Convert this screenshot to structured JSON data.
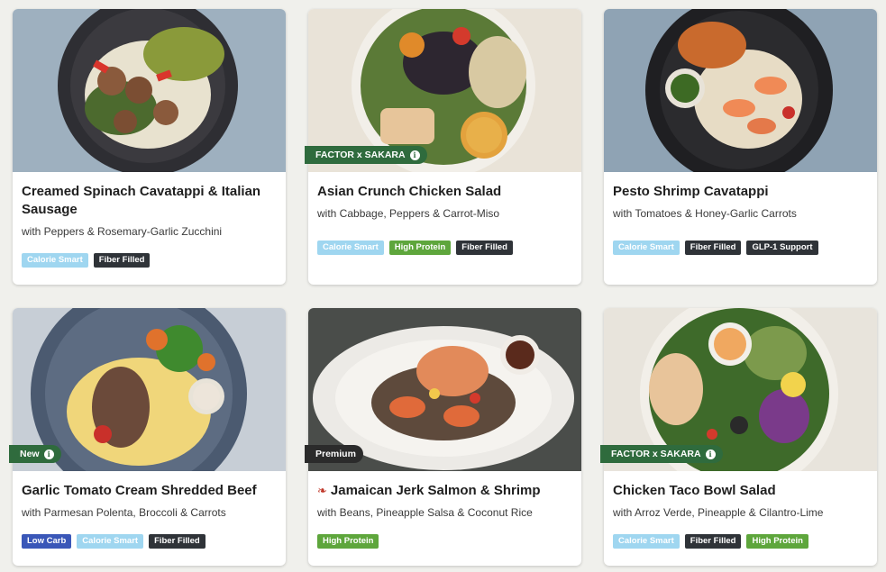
{
  "cards": [
    {
      "title": "Creamed Spinach Cavatappi & Italian Sausage",
      "subtitle": "with Peppers & Rosemary-Garlic Zucchini",
      "tags": [
        "Calorie Smart",
        "Fiber Filled"
      ],
      "image": "pasta-sausage-bowl-image"
    },
    {
      "title": "Asian Crunch Chicken Salad",
      "subtitle": "with Cabbage, Peppers & Carrot-Miso",
      "tags": [
        "Calorie Smart",
        "High Protein",
        "Fiber Filled"
      ],
      "badge": "FACTOR x SAKARA",
      "image": "chicken-salad-image"
    },
    {
      "title": "Pesto Shrimp Cavatappi",
      "subtitle": "with Tomatoes & Honey-Garlic Carrots",
      "tags": [
        "Calorie Smart",
        "Fiber Filled",
        "GLP-1 Support"
      ],
      "image": "shrimp-pasta-image"
    },
    {
      "title": "Garlic Tomato Cream Shredded Beef",
      "subtitle": "with Parmesan Polenta, Broccoli & Carrots",
      "tags": [
        "Low Carb",
        "Calorie Smart",
        "Fiber Filled"
      ],
      "badge": "New",
      "image": "shredded-beef-image"
    },
    {
      "title": "Jamaican Jerk Salmon & Shrimp",
      "subtitle": "with Beans, Pineapple Salsa & Coconut Rice",
      "tags": [
        "High Protein"
      ],
      "badge": "Premium",
      "spicy": true,
      "image": "salmon-shrimp-image"
    },
    {
      "title": "Chicken Taco Bowl Salad",
      "subtitle": "with Arroz Verde, Pineapple & Cilantro-Lime",
      "tags": [
        "Calorie Smart",
        "Fiber Filled",
        "High Protein"
      ],
      "badge": "FACTOR x SAKARA",
      "image": "taco-bowl-image"
    }
  ],
  "colors": {
    "background": "#f0f0ec",
    "badge_green": "#2f6b3d",
    "badge_dark": "#2b2b2b",
    "tag_calorie": "#9fd6f0",
    "tag_fiber": "#2f3338",
    "tag_protein": "#5ea63c",
    "tag_lowcarb": "#3a57b8"
  }
}
